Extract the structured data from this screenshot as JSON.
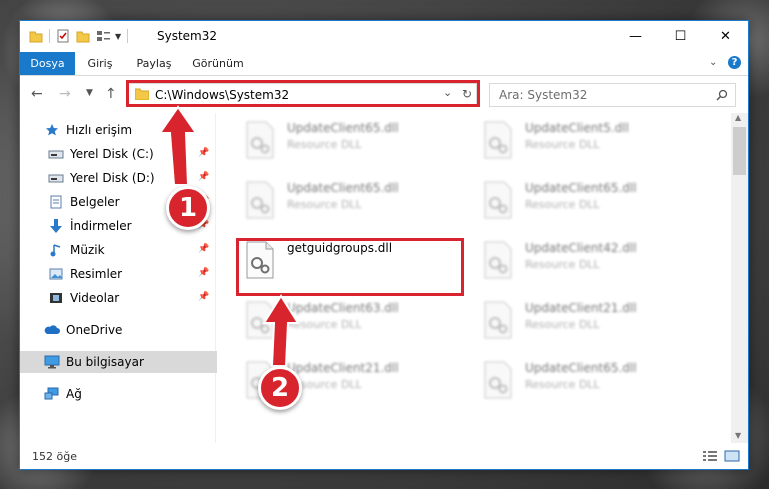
{
  "window": {
    "title": "System32",
    "controls": {
      "minimize": "—",
      "maximize": "☐",
      "close": "✕"
    }
  },
  "ribbon": {
    "tabs": [
      {
        "label": "Dosya",
        "active": true
      },
      {
        "label": "Giriş"
      },
      {
        "label": "Paylaş"
      },
      {
        "label": "Görünüm"
      }
    ],
    "expand_icon": "chevron-down-icon",
    "help_icon": "help-icon"
  },
  "navigation": {
    "address": "C:\\Windows\\System32",
    "search_placeholder": "Ara: System32"
  },
  "sidebar": {
    "items": [
      {
        "label": "Hızlı erişim",
        "icon": "star-icon"
      },
      {
        "label": "Yerel Disk (C:)",
        "icon": "drive-icon",
        "pinned": true
      },
      {
        "label": "Yerel Disk (D:)",
        "icon": "drive-icon",
        "pinned": true
      },
      {
        "label": "Belgeler",
        "icon": "documents-icon",
        "pinned": true
      },
      {
        "label": "İndirmeler",
        "icon": "download-icon",
        "pinned": true
      },
      {
        "label": "Müzik",
        "icon": "music-icon",
        "pinned": true
      },
      {
        "label": "Resimler",
        "icon": "pictures-icon",
        "pinned": true
      },
      {
        "label": "Videolar",
        "icon": "videos-icon",
        "pinned": true
      },
      {
        "label": "OneDrive",
        "icon": "cloud-icon"
      },
      {
        "label": "Bu bilgisayar",
        "icon": "computer-icon",
        "selected": true
      },
      {
        "label": "Ağ",
        "icon": "network-icon"
      }
    ]
  },
  "files": [
    {
      "name": "UpdateClient65.dll",
      "type": "Resource DLL"
    },
    {
      "name": "UpdateClient5.dll",
      "type": "Resource DLL"
    },
    {
      "name": "UpdateClient65.dll",
      "type": "Resource DLL"
    },
    {
      "name": "UpdateClient65.dll",
      "type": "Resource DLL"
    },
    {
      "name": "getguidgroups.dll",
      "type": ""
    },
    {
      "name": "UpdateClient42.dll",
      "type": "Resource DLL"
    },
    {
      "name": "UpdateClient63.dll",
      "type": "Resource DLL"
    },
    {
      "name": "UpdateClient21.dll",
      "type": "Resource DLL"
    },
    {
      "name": "UpdateClient21.dll",
      "type": "Resource DLL"
    },
    {
      "name": "UpdateClient65.dll",
      "type": "Resource DLL"
    }
  ],
  "status": {
    "item_count": "152 öğe"
  },
  "annotations": {
    "step1": "1",
    "step2": "2"
  },
  "colors": {
    "accent": "#1979ca",
    "highlight": "#d9232e"
  }
}
